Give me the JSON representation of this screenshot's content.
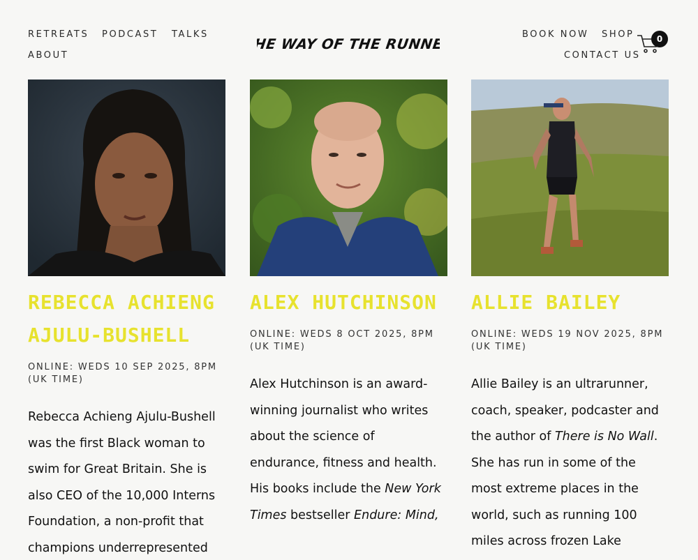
{
  "header": {
    "nav_left": [
      "RETREATS",
      "PODCAST",
      "TALKS",
      "ABOUT"
    ],
    "logo_text": "THE WAY OF THE RUNNER",
    "nav_right": [
      "BOOK NOW",
      "SHOP",
      "CONTACT US"
    ],
    "cart_count": "0"
  },
  "colors": {
    "accent": "#e7e22e",
    "background": "#f7f7f5",
    "text": "#111111"
  },
  "speakers": [
    {
      "name": "REBECCA ACHIENG AJULU-BUSHELL",
      "date": "ONLINE: WEDS 10 SEP 2025, 8PM (UK TIME)",
      "bio": [
        {
          "t": "Rebecca Achieng Ajulu-Bushell was the first Black woman to swim for Great Britain. She is also CEO of the 10,000 Interns Foundation, a non-profit that champions underrepresented"
        }
      ]
    },
    {
      "name": "ALEX HUTCHINSON",
      "date": "ONLINE: WEDS 8 OCT 2025, 8PM (UK TIME)",
      "bio": [
        {
          "t": "Alex Hutchinson is an award-winning journalist who writes about the science of endurance, fitness and health. His books include the "
        },
        {
          "t": "New York Times",
          "i": true
        },
        {
          "t": " bestseller "
        },
        {
          "t": "Endure: Mind,",
          "i": true
        }
      ]
    },
    {
      "name": "ALLIE BAILEY",
      "date": "ONLINE: WEDS 19 NOV 2025, 8PM (UK TIME)",
      "bio": [
        {
          "t": "Allie Bailey is an ultrarunner, coach, speaker, podcaster and the author of "
        },
        {
          "t": "There is No Wall",
          "i": true
        },
        {
          "t": ". She has run in some of the most extreme places in the world, such as running 100 miles across frozen Lake Khövsgöl in"
        }
      ]
    }
  ]
}
